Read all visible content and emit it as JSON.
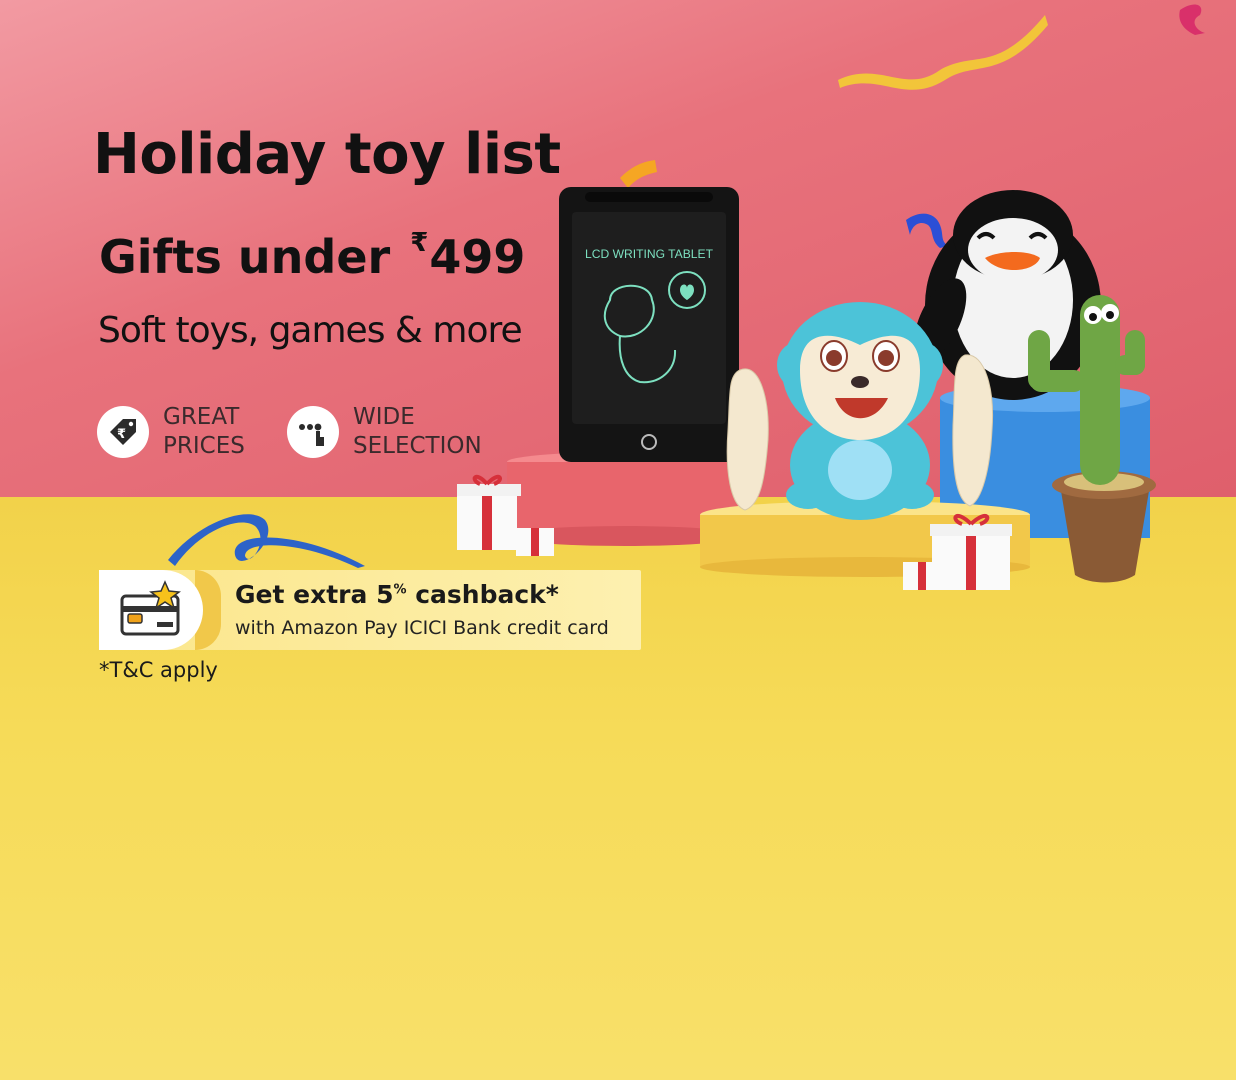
{
  "banner": {
    "title": "Holiday toy list",
    "subtitle_prefix": "Gifts under ",
    "currency_symbol": "₹",
    "price": "499",
    "tagline": "Soft toys, games & more",
    "features": [
      {
        "icon": "price-tag-rupee-icon",
        "label_line1": "GREAT",
        "label_line2": "PRICES"
      },
      {
        "icon": "hand-select-icon",
        "label_line1": "WIDE",
        "label_line2": "SELECTION"
      }
    ]
  },
  "offer": {
    "icon": "credit-card-star-icon",
    "title_prefix": "Get extra 5",
    "title_sup": "%",
    "title_suffix": " cashback*",
    "subtitle": "with Amazon Pay ICICI Bank credit card"
  },
  "tnc": "*T&C apply",
  "tablet_screen_text": "LCD WRITING TABLET",
  "colors": {
    "top_background": "#e8727c",
    "bottom_background": "#f6db58",
    "text_dark": "#111111"
  }
}
